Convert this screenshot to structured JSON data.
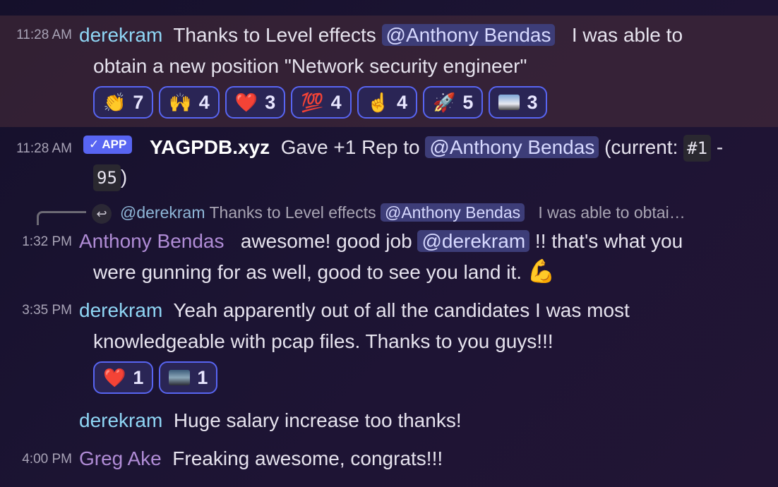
{
  "messages": [
    {
      "time": "11:28 AM",
      "user": "derekram",
      "text_pre": "Thanks to Level effects",
      "mention": "@Anthony Bendas",
      "text_post": "I was able to",
      "line2": "obtain a new position \"Network security engineer\"",
      "reactions": [
        {
          "emoji": "clapping-hands",
          "glyph": "👏",
          "count": "7"
        },
        {
          "emoji": "raising-hands",
          "glyph": "🙌",
          "count": "4"
        },
        {
          "emoji": "red-heart",
          "glyph": "❤️",
          "count": "3"
        },
        {
          "emoji": "hundred-points",
          "glyph": "💯",
          "count": "4"
        },
        {
          "emoji": "index-pointing-up",
          "glyph": "☝️",
          "count": "4"
        },
        {
          "emoji": "rocket",
          "glyph": "🚀",
          "count": "5"
        },
        {
          "emoji": "custom-image",
          "glyph": "",
          "count": "3"
        }
      ]
    },
    {
      "time": "11:28 AM",
      "badge": "✓ APP",
      "user": "YAGPDB.xyz",
      "text_pre": "Gave +1 Rep to",
      "mention": "@Anthony Bendas",
      "text_mid": "(current:",
      "code1": "#1",
      "text_dash": "-",
      "code2": "95",
      "text_end": ")"
    },
    {
      "reply_user": "@derekram",
      "reply_pre": "Thanks to Level effects",
      "reply_mention": "@Anthony Bendas",
      "reply_post": "I was able to obtai…",
      "time": "1:32 PM",
      "user": "Anthony Bendas",
      "text_pre": "awesome! good job",
      "mention": "@derekram",
      "text_post": "!! that's what you",
      "line2": "were gunning for as well, good to see you land it.",
      "emoji": "💪"
    },
    {
      "time": "3:35 PM",
      "user": "derekram",
      "text": "Yeah apparently out of all the  candidates I was most",
      "line2": "knowledgeable with pcap files. Thanks to you guys!!!",
      "reactions": [
        {
          "emoji": "red-heart",
          "glyph": "❤️",
          "count": "1"
        },
        {
          "emoji": "custom-image",
          "glyph": "",
          "count": "1"
        }
      ]
    },
    {
      "user": "derekram",
      "text": "Huge salary increase too thanks!"
    },
    {
      "time": "4:00 PM",
      "user": "Greg Ake",
      "text": "Freaking awesome, congrats!!!"
    }
  ]
}
